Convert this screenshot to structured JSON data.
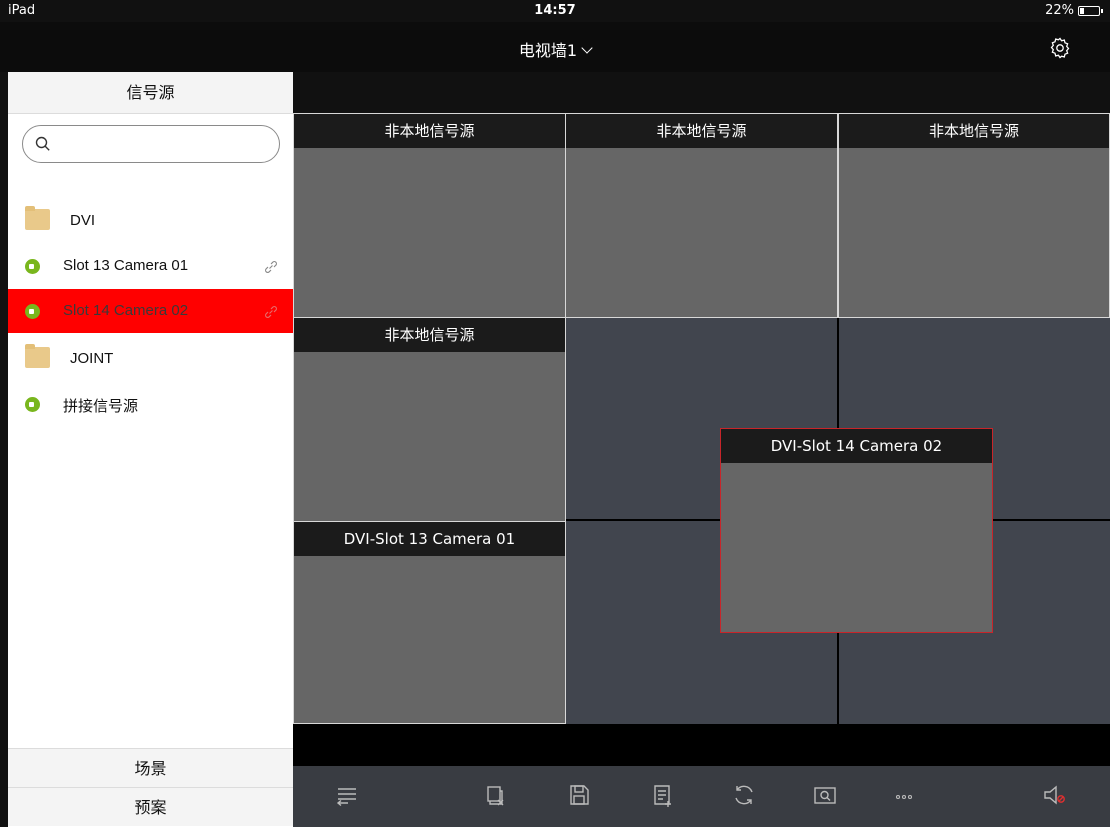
{
  "statusbar": {
    "device": "iPad",
    "time": "14:57",
    "battery": "22%"
  },
  "navbar": {
    "title": "电视墙1",
    "settings_icon": "gear-icon"
  },
  "sidebar": {
    "tab_label": "信号源",
    "search_placeholder": "",
    "items": [
      {
        "type": "folder",
        "label": "DVI"
      },
      {
        "type": "camera",
        "label": "Slot 13 Camera 01",
        "linked": true
      },
      {
        "type": "camera",
        "label": "Slot 14 Camera 02",
        "linked": true,
        "selected": true
      },
      {
        "type": "folder",
        "label": "JOINT"
      },
      {
        "type": "camera",
        "label": "拼接信号源"
      }
    ]
  },
  "bottom_tabs": [
    "场景",
    "预案"
  ],
  "wall": {
    "windows": [
      {
        "title": "非本地信号源"
      },
      {
        "title": "非本地信号源"
      },
      {
        "title": "非本地信号源"
      },
      {
        "title": "非本地信号源"
      },
      {
        "title": "DVI-Slot 13 Camera 01"
      },
      {
        "title": "DVI-Slot 14 Camera 02",
        "active": true
      }
    ]
  },
  "toolbar": {
    "buttons": [
      "collapse-list-icon",
      "close-window-icon",
      "save-icon",
      "add-plan-icon",
      "refresh-icon",
      "preview-icon",
      "more-icon",
      "mute-icon"
    ]
  },
  "colors": {
    "selected_row": "#ff0000",
    "camera_icon": "#79b61d",
    "wall_background": "#41454e",
    "active_window_border": "#c8252a"
  }
}
